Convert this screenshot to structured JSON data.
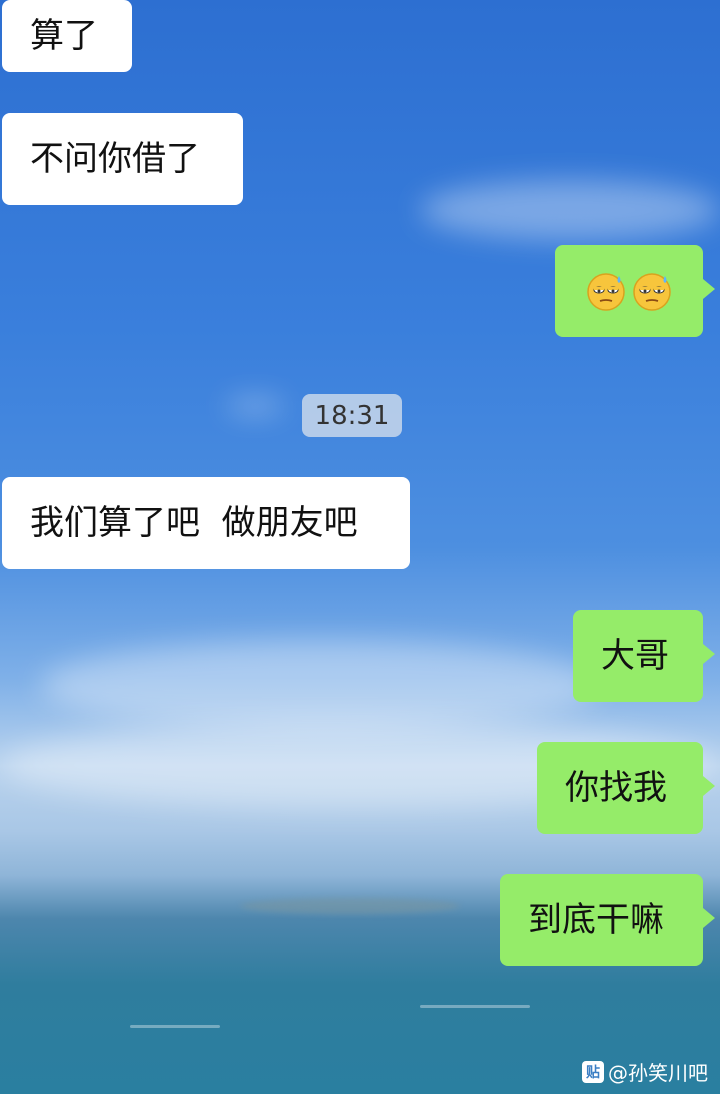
{
  "messages": [
    {
      "side": "left",
      "text": "算了"
    },
    {
      "side": "left",
      "text": "不问你借了"
    },
    {
      "side": "right",
      "emoji": [
        "sweat-smile-emoji",
        "sweat-smile-emoji"
      ]
    },
    {
      "side": "left",
      "text": "我们算了吧  做朋友吧"
    },
    {
      "side": "right",
      "text": "大哥"
    },
    {
      "side": "right",
      "text": "你找我"
    },
    {
      "side": "right",
      "text": "到底干嘛"
    }
  ],
  "timestamp": "18:31",
  "watermark": {
    "icon": "贴",
    "text": "@孙笑川吧"
  },
  "colors": {
    "incoming": "#ffffff",
    "outgoing": "#95ec69"
  }
}
